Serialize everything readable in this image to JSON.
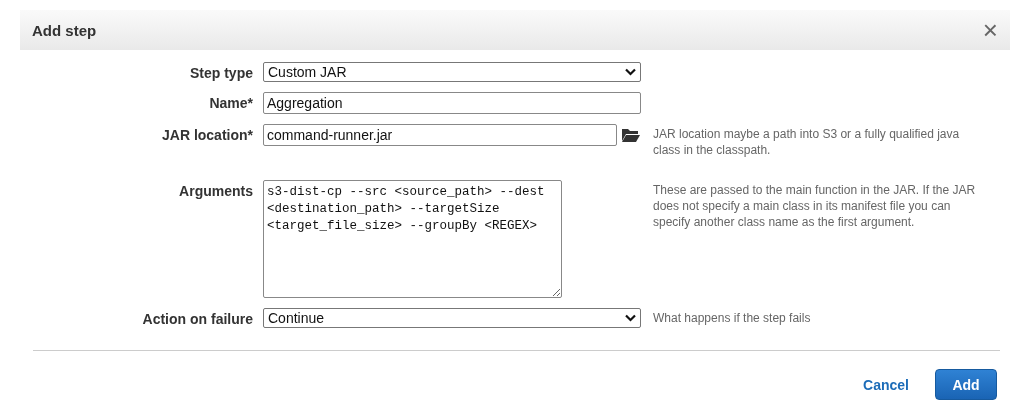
{
  "dialog": {
    "title": "Add step",
    "close": "×"
  },
  "fields": [
    {
      "kind": "select",
      "label": "Step type",
      "value": "Custom JAR"
    },
    {
      "kind": "text",
      "label": "Name*",
      "value": "Aggregation"
    },
    {
      "kind": "file",
      "label": "JAR location*",
      "value": "command-runner.jar",
      "help": "JAR location maybe a path into S3 or a fully qualified java class in the classpath."
    },
    {
      "kind": "textarea",
      "label": "Arguments",
      "value": "s3-dist-cp --src <source_path> --dest <destination_path> --targetSize <target_file_size> --groupBy <REGEX>",
      "help": "These are passed to the main function in the JAR. If the JAR does not specify a main class in its manifest file you can specify another class name as the first argument."
    },
    {
      "kind": "select",
      "label": "Action on failure",
      "value": "Continue",
      "help": "What happens if the step fails"
    }
  ],
  "buttons": [
    {
      "kind": "link",
      "label": "Cancel"
    },
    {
      "kind": "primary",
      "label": "Add"
    }
  ]
}
